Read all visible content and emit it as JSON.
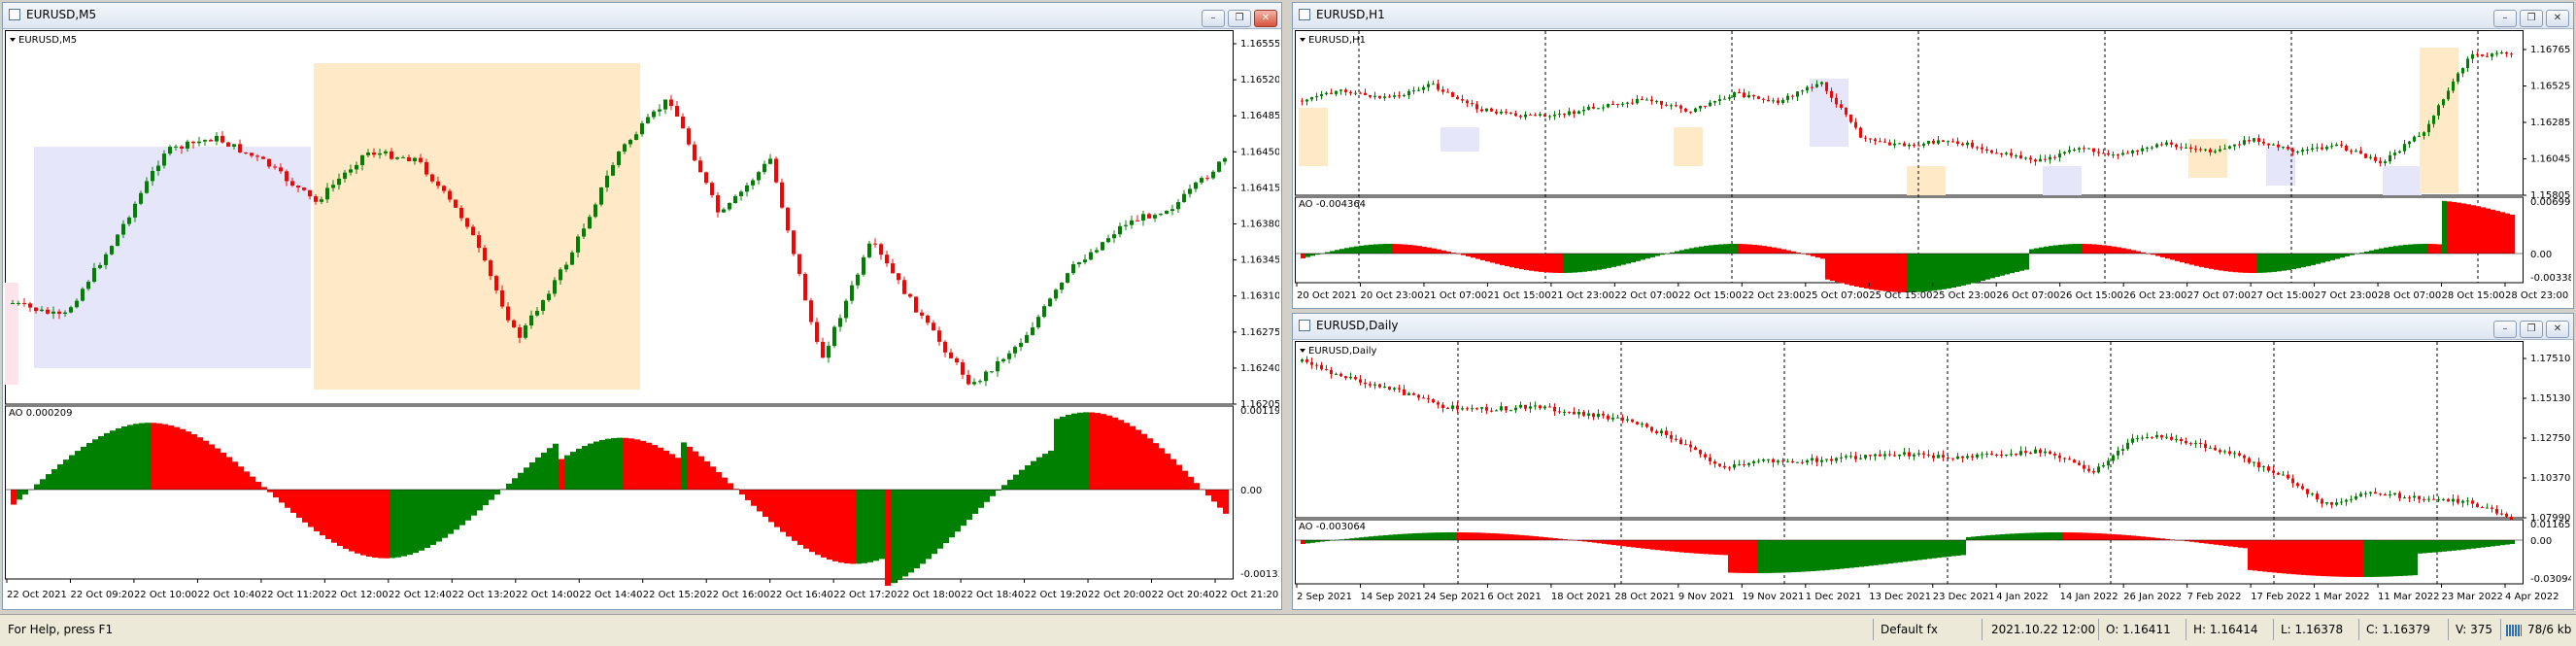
{
  "status": {
    "help": "For Help, press F1",
    "profile": "Default fx",
    "datetime": "2021.10.22 12:00",
    "open": "O: 1.16411",
    "high": "H: 1.16414",
    "low": "L: 1.16378",
    "close": "C: 1.16379",
    "volume": "V: 375",
    "traffic": "78/6 kb"
  },
  "windows": {
    "m5": {
      "title": "EURUSD,M5",
      "label": "EURUSD,M5",
      "ao_label": "AO 0.000209",
      "price_ticks": [
        "1.16555",
        "1.16520",
        "1.16485",
        "1.16450",
        "1.16415",
        "1.16380",
        "1.16345",
        "1.16310",
        "1.16275",
        "1.16240",
        "1.16205"
      ],
      "ao_ticks": [
        "0.001198",
        "0.00",
        "-0.001336"
      ],
      "time_ticks": [
        "22 Oct 2021",
        "22 Oct 09:20",
        "22 Oct 10:00",
        "22 Oct 10:40",
        "22 Oct 11:20",
        "22 Oct 12:00",
        "22 Oct 12:40",
        "22 Oct 13:20",
        "22 Oct 14:00",
        "22 Oct 14:40",
        "22 Oct 15:20",
        "22 Oct 16:00",
        "22 Oct 16:40",
        "22 Oct 17:20",
        "22 Oct 18:00",
        "22 Oct 18:40",
        "22 Oct 19:20",
        "22 Oct 20:00",
        "22 Oct 20:40",
        "22 Oct 21:20"
      ]
    },
    "h1": {
      "title": "EURUSD,H1",
      "label": "EURUSD,H1",
      "ao_label": "AO -0.004364",
      "price_ticks": [
        "1.16765",
        "1.16525",
        "1.16285",
        "1.16045",
        "1.15805"
      ],
      "ao_ticks": [
        "0.006996",
        "0.00",
        "-0.003386"
      ],
      "time_ticks": [
        "20 Oct 2021",
        "20 Oct 23:00",
        "21 Oct 07:00",
        "21 Oct 15:00",
        "21 Oct 23:00",
        "22 Oct 07:00",
        "22 Oct 15:00",
        "22 Oct 23:00",
        "25 Oct 07:00",
        "25 Oct 15:00",
        "25 Oct 23:00",
        "26 Oct 07:00",
        "26 Oct 15:00",
        "26 Oct 23:00",
        "27 Oct 07:00",
        "27 Oct 15:00",
        "27 Oct 23:00",
        "28 Oct 07:00",
        "28 Oct 15:00",
        "28 Oct 23:00"
      ]
    },
    "d1": {
      "title": "EURUSD,Daily",
      "label": "EURUSD,Daily",
      "ao_label": "AO -0.003064",
      "price_ticks": [
        "1.17510",
        "1.15130",
        "1.12750",
        "1.10370",
        "1.07990"
      ],
      "ao_ticks": [
        "0.011657",
        "0.00",
        "-0.030946"
      ],
      "time_ticks": [
        "2 Sep 2021",
        "14 Sep 2021",
        "24 Sep 2021",
        "6 Oct 2021",
        "18 Oct 2021",
        "28 Oct 2021",
        "9 Nov 2021",
        "19 Nov 2021",
        "1 Dec 2021",
        "13 Dec 2021",
        "23 Dec 2021",
        "4 Jan 2022",
        "14 Jan 2022",
        "26 Jan 2022",
        "7 Feb 2022",
        "17 Feb 2022",
        "1 Mar 2022",
        "11 Mar 2022",
        "23 Mar 2022",
        "4 Apr 2022"
      ]
    }
  },
  "colors": {
    "bull": "#008000",
    "bear": "#ff0000",
    "box_blue": "#e6e6fa",
    "box_orange": "#ffe9c7",
    "box_pink": "#fde4ec"
  }
}
